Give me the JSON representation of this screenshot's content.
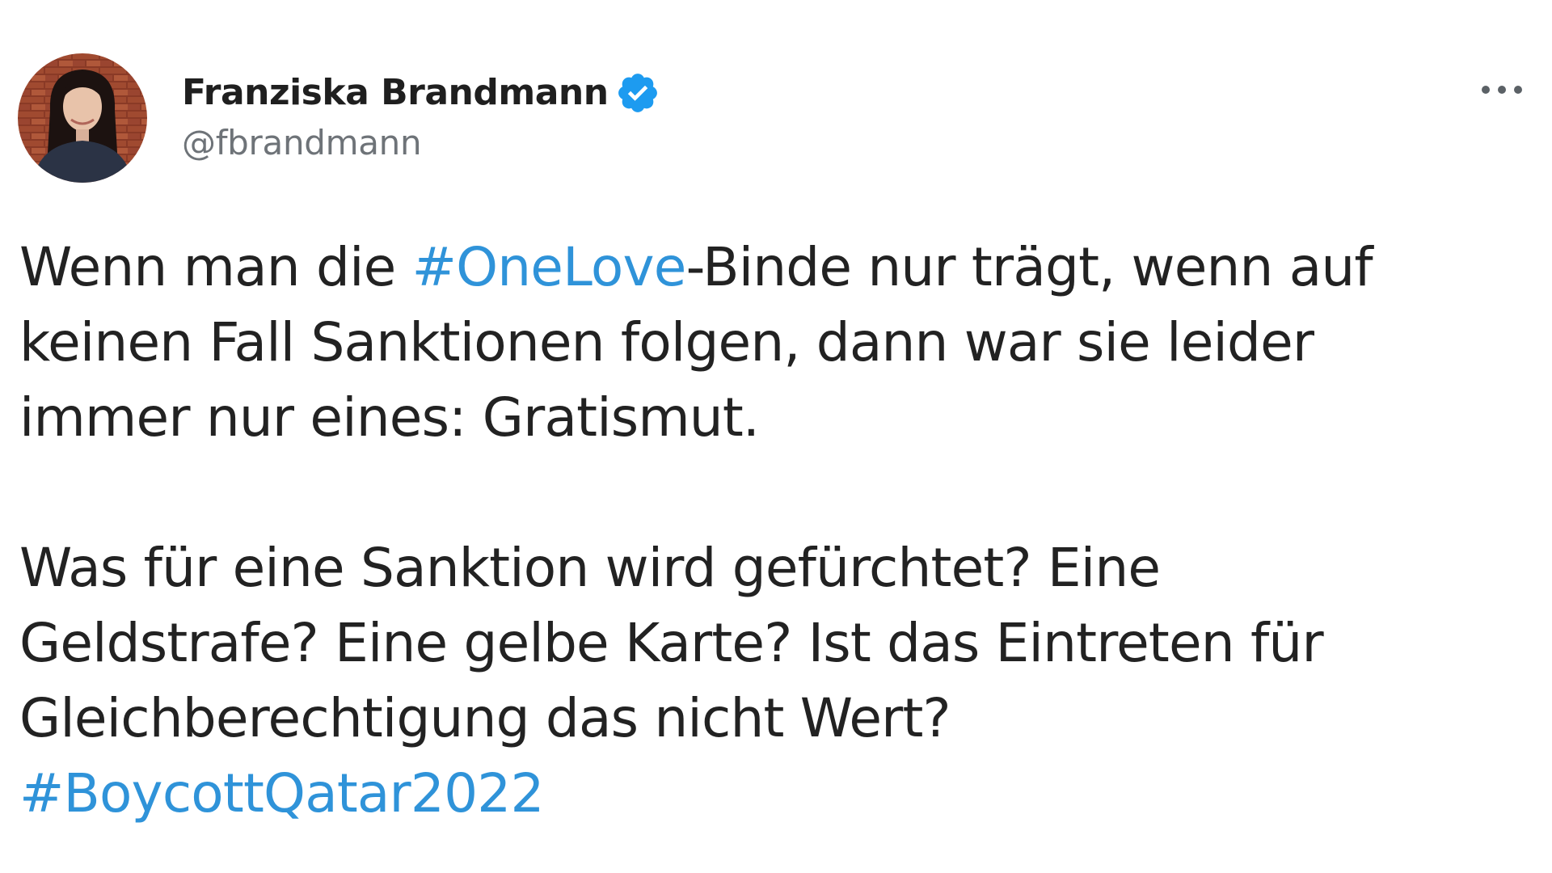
{
  "author": {
    "display_name": "Franziska Brandmann",
    "handle": "@fbrandmann",
    "verified": true,
    "avatar_icon": "profile-photo"
  },
  "menu": {
    "icon": "more-horizontal-icon"
  },
  "tweet": {
    "paragraph1": {
      "line1_before": "Wenn man die ",
      "hashtag1": "#OneLove",
      "line1_after": "-Binde nur trägt, wenn auf",
      "line2": "keinen Fall Sanktionen folgen, dann war sie leider",
      "line3": "immer nur eines: Gratismut."
    },
    "paragraph2": {
      "line1": "Was für eine Sanktion wird gefürchtet? Eine",
      "line2": "Geldstrafe? Eine gelbe Karte? Ist das Eintreten für",
      "line3": "Gleichberechtigung das nicht Wert?",
      "hashtag2": "#BoycottQatar2022"
    }
  },
  "colors": {
    "hashtag": "#2f93d9",
    "verified_badge": "#1d9bf0",
    "text": "#222222",
    "handle": "#6e7378"
  }
}
